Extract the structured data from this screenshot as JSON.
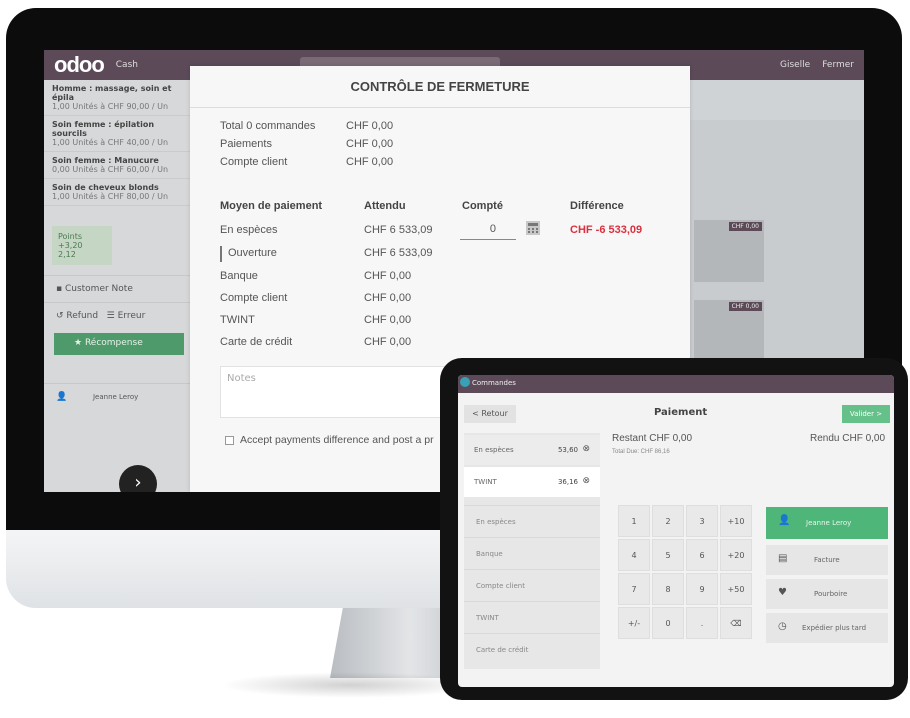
{
  "pos": {
    "logo": "odoo",
    "topbar_cash": "Cash",
    "topbar_user": "Giselle",
    "topbar_close": "Fermer",
    "order_lines": [
      {
        "name": "Homme : massage, soin et épila",
        "detail": "1,00 Unités à CHF 90,00 / Un"
      },
      {
        "name": "Soin femme : épilation sourcils",
        "detail": "1,00 Unités à CHF 40,00 / Un"
      },
      {
        "name": "Soin femme : Manucure",
        "detail": "0,00 Unités à CHF 60,00 / Un"
      },
      {
        "name": "Soin de cheveux blonds",
        "detail": "1,00 Unités à CHF 80,00 / Un"
      }
    ],
    "total_box": {
      "label": "Points",
      "line1": "+3,20",
      "line2": "2,12"
    },
    "customer_note": "Customer Note",
    "refund": "Refund",
    "error": "Erreur",
    "reward": "Récompense",
    "customer_name": "Jeanne Leroy",
    "product_prices": [
      "CHF 0,00",
      "CHF 0,00"
    ]
  },
  "modal": {
    "title": "CONTRÔLE DE FERMETURE",
    "summary": [
      {
        "label": "Total 0 commandes",
        "value": "CHF 0,00"
      },
      {
        "label": "Paiements",
        "value": "CHF 0,00"
      },
      {
        "label": "Compte client",
        "value": "CHF 0,00"
      }
    ],
    "headers": {
      "method": "Moyen de paiement",
      "expected": "Attendu",
      "counted": "Compté",
      "difference": "Différence"
    },
    "cash_row": {
      "method": "En espèces",
      "expected": "CHF 6 533,09",
      "counted": "0",
      "difference": "CHF -6 533,09"
    },
    "opening_row": {
      "method": "Ouverture",
      "expected": "CHF 6 533,09"
    },
    "rows": [
      {
        "method": "Banque",
        "expected": "CHF 0,00"
      },
      {
        "method": "Compte client",
        "expected": "CHF 0,00"
      },
      {
        "method": "TWINT",
        "expected": "CHF 0,00"
      },
      {
        "method": "Carte de crédit",
        "expected": "CHF 0,00"
      }
    ],
    "notes_placeholder": "Notes",
    "accept_label": "Accept payments difference and post a pr"
  },
  "tablet": {
    "topbar_label": "Commandes",
    "back": "< Retour",
    "title": "Paiement",
    "validate": "Valider >",
    "payment_lines": [
      {
        "method": "En espèces",
        "amount": "53,60"
      },
      {
        "method": "TWINT",
        "amount": "36,16"
      }
    ],
    "methods": [
      "En espèces",
      "Banque",
      "Compte client",
      "TWINT",
      "Carte de crédit"
    ],
    "remaining": "Restant CHF 0,00",
    "total_due": "Total Due: CHF 86,16",
    "change": "Rendu CHF 0,00",
    "keys": [
      "1",
      "2",
      "3",
      "+10",
      "4",
      "5",
      "6",
      "+20",
      "7",
      "8",
      "9",
      "+50",
      "+/-",
      "0",
      ".",
      "⌫"
    ],
    "customer_button": "Jeanne Leroy",
    "invoice": "Facture",
    "tip": "Pourboire",
    "ship_later": "Expédier plus tard"
  },
  "colors": {
    "odoo_purple": "#5c4a58",
    "success_green": "#4eb679",
    "difference_red": "#d9313f"
  }
}
